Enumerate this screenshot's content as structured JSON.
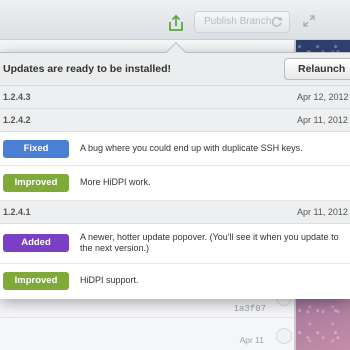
{
  "toolbar": {
    "publish_label": "Publish Branch"
  },
  "popover": {
    "title": "Updates are ready to be installed!",
    "relaunch_label": "Relaunch",
    "versions": [
      {
        "version": "1.2.4.3",
        "date": "Apr 12, 2012",
        "changes": []
      },
      {
        "version": "1.2.4.2",
        "date": "Apr 11, 2012",
        "changes": [
          {
            "tag": "Fixed",
            "text": "A bug where you could end up with duplicate SSH keys."
          },
          {
            "tag": "Improved",
            "text": "More HiDPI work."
          }
        ]
      },
      {
        "version": "1.2.4.1",
        "date": "Apr 11, 2012",
        "changes": [
          {
            "tag": "Added",
            "text": "A newer, hotter update popover. (You'll see it when you update to the next version.)"
          },
          {
            "tag": "Improved",
            "text": "HiDPI support."
          }
        ]
      }
    ]
  },
  "history": {
    "commit_sha": "1a3f07",
    "commit_date": "Apr 11"
  },
  "colors": {
    "fixed": "#4a7fd3",
    "improved": "#7faa3a",
    "added": "#7b3fc4",
    "share_icon": "#5aa843"
  },
  "icons": {
    "share": "share-icon",
    "sync": "sync-icon",
    "fullscreen": "fullscreen-icon"
  }
}
